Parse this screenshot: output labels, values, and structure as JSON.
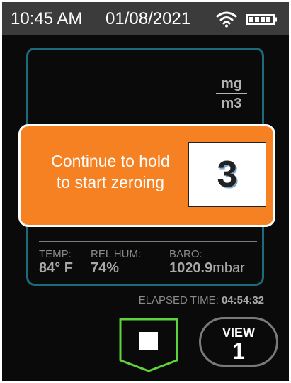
{
  "status_bar": {
    "time": "10:45 AM",
    "date": "01/08/2021",
    "wifi_icon": "wifi-icon",
    "battery_icon": "battery-full-icon"
  },
  "measurement": {
    "unit_numerator": "mg",
    "unit_denominator": "m3"
  },
  "dialog": {
    "line1": "Continue to hold",
    "line2": "to start zeroing",
    "countdown": "3"
  },
  "readings": {
    "temp_label": "TEMP:",
    "temp_value": "84° F",
    "hum_label": "REL HUM:",
    "hum_value": "74%",
    "baro_label": "BARO:",
    "baro_value": "1020.9",
    "baro_unit": "mbar"
  },
  "elapsed": {
    "label": "ELAPSED TIME:",
    "value": "04:54:32"
  },
  "controls": {
    "stop_icon": "stop-icon",
    "view_label": "VIEW",
    "view_number": "1"
  },
  "colors": {
    "accent_orange": "#f58123",
    "panel_border": "#1b6b7a",
    "stop_border": "#5fd33a",
    "status_bar_bg": "#3b3b3b"
  }
}
